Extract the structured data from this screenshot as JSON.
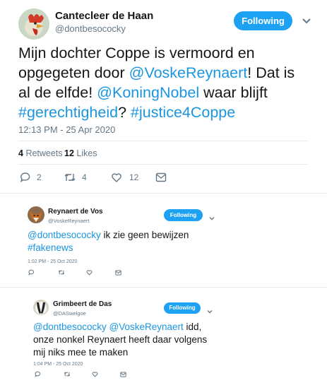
{
  "main_tweet": {
    "author_name": "Cantecleer de Haan",
    "handle": "@dontbesococky",
    "follow_label": "Following",
    "text_parts": [
      {
        "t": "Mijn dochter Coppe is vermoord en opgegeten door ",
        "link": false
      },
      {
        "t": "@VoskeReynaert",
        "link": true
      },
      {
        "t": "! Dat is al de elfde! ",
        "link": false
      },
      {
        "t": "@KoningNobel",
        "link": true
      },
      {
        "t": " waar blijft ",
        "link": false
      },
      {
        "t": "#gerechtigheid",
        "link": true
      },
      {
        "t": "? ",
        "link": false
      },
      {
        "t": "#justice4Coppe",
        "link": true
      }
    ],
    "timestamp": "12:13 PM - 25 Apr 2020",
    "retweets_count": "4",
    "retweets_label": "Retweets",
    "likes_count": "12",
    "likes_label": "Likes",
    "reply_count": "2",
    "retweet_action_count": "4",
    "like_action_count": "12"
  },
  "reply1": {
    "author_name": "Reynaert de Vos",
    "handle": "@VoskeReynaert",
    "follow_label": "Following",
    "text_parts": [
      {
        "t": "@dontbesococky",
        "link": true
      },
      {
        "t": " ik zie geen bewijzen ",
        "link": false
      },
      {
        "t": "#fakenews",
        "link": true
      }
    ],
    "timestamp": "1:02 PM - 25 Oct 2020"
  },
  "reply2": {
    "author_name": "Grimbeert de Das",
    "handle": "@DASwelgoe",
    "follow_label": "Following",
    "text_parts": [
      {
        "t": "@dontbesococky",
        "link": true
      },
      {
        "t": " ",
        "link": false
      },
      {
        "t": "@VoskeReynaert",
        "link": true
      },
      {
        "t": " idd, onze nonkel Reynaert heeft daar volgens mij niks mee te maken",
        "link": false
      }
    ],
    "timestamp": "1:04 PM - 25 Oct 2020"
  },
  "colors": {
    "accent": "#1da1f2",
    "link": "#1b95e0",
    "muted": "#657786",
    "text": "#14171a"
  },
  "icons": [
    "rooster-avatar",
    "fox-avatar",
    "badger-avatar",
    "reply-icon",
    "retweet-icon",
    "like-icon",
    "message-icon",
    "chevron-down-icon"
  ]
}
